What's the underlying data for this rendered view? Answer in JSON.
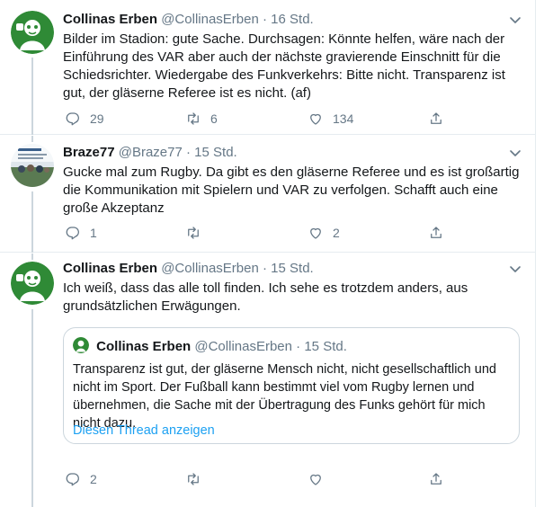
{
  "tweets": [
    {
      "name": "Collinas Erben",
      "handle": "@CollinasErben",
      "dot": "·",
      "time": "16 Std.",
      "text": "Bilder im Stadion: gute Sache. Durchsagen: Könnte helfen, wäre nach der Einführung des VAR aber auch der nächste gravierende Einschnitt für die Schiedsrichter. Wiedergabe des Funkverkehrs: Bitte nicht. Transparenz ist gut, der gläserne Referee ist es nicht. (af)",
      "replies": "29",
      "retweets": "6",
      "likes": "134"
    },
    {
      "name": "Braze77",
      "handle": "@Braze77",
      "dot": "·",
      "time": "15 Std.",
      "text": "Gucke mal zum Rugby. Da gibt es den gläserne Referee und es ist großartig die Kommunikation mit Spielern und VAR zu verfolgen. Schafft auch eine große Akzeptanz",
      "replies": "1",
      "retweets": "",
      "likes": "2"
    },
    {
      "name": "Collinas Erben",
      "handle": "@CollinasErben",
      "dot": "·",
      "time": "15 Std.",
      "text": "Ich weiß, dass das alle toll finden. Ich sehe es trotzdem anders, aus grundsätzlichen Erwägungen.",
      "replies": "2",
      "retweets": "",
      "likes": "",
      "quote": {
        "name": "Collinas Erben",
        "handle": "@CollinasErben",
        "dot": "·",
        "time": "15 Std.",
        "text": "Transparenz ist gut, der gläserne Mensch nicht, nicht gesellschaftlich und nicht im Sport. Der Fußball kann bestimmt viel vom Rugby lernen und übernehmen, die Sache mit der Übertragung des Funks gehört für mich nicht dazu.",
        "link": "Diesen Thread anzeigen"
      }
    }
  ],
  "icons": {
    "reply": "reply-icon",
    "retweet": "retweet-icon",
    "like": "heart-icon",
    "share": "share-icon",
    "caret": "chevron-down-icon"
  },
  "colors": {
    "secondary_text": "#657786",
    "link": "#1da1f2",
    "border": "#e6ecf0",
    "thread_line": "#ccd6dd",
    "avatar_green": "#2f8a36"
  }
}
